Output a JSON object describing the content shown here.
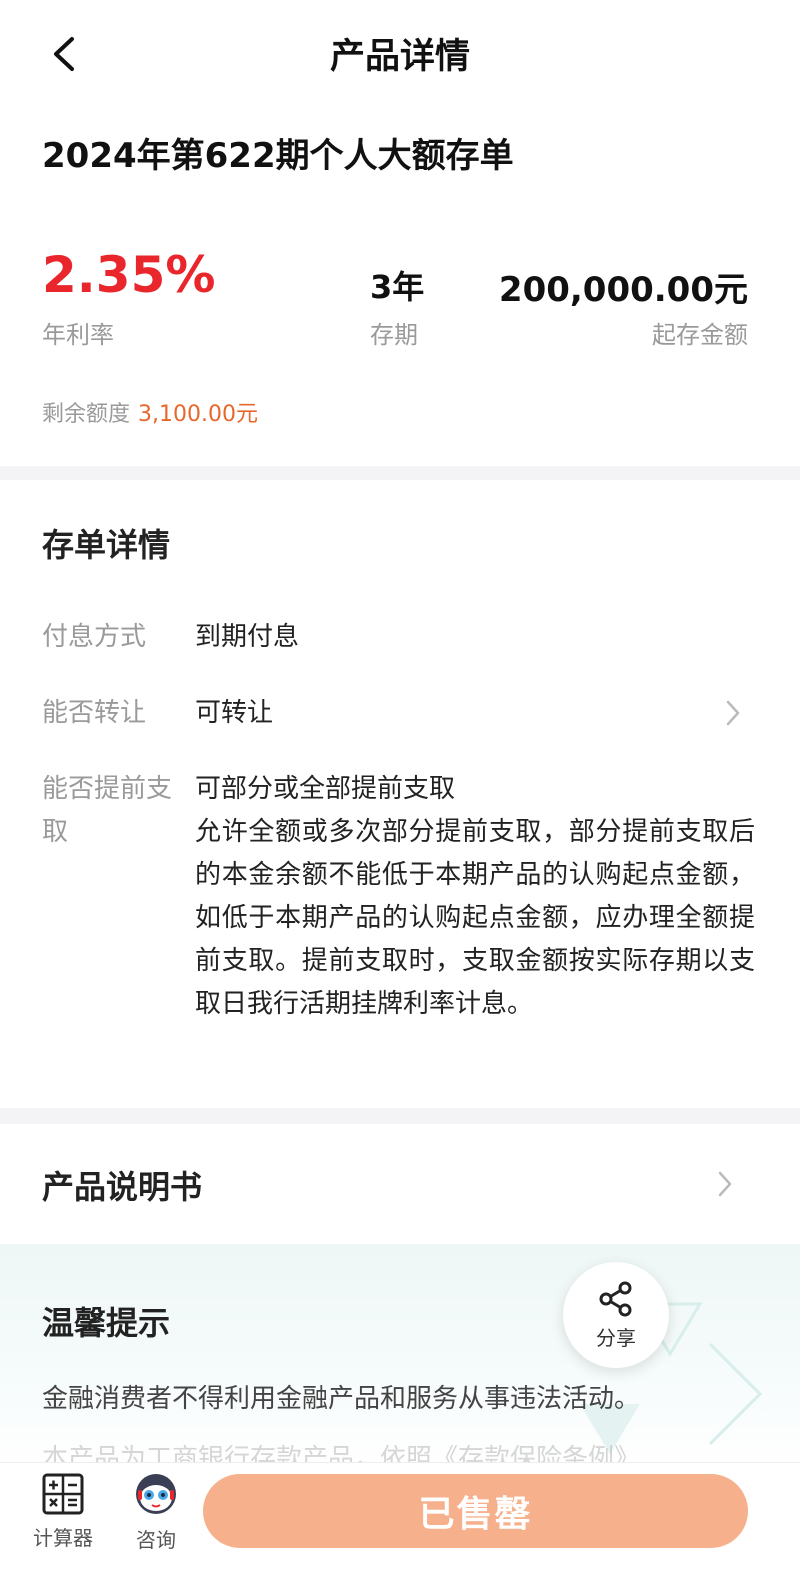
{
  "header": {
    "title": "产品详情",
    "back_icon": "chevron-left-icon"
  },
  "product": {
    "name": "2024年第622期个人大额存单"
  },
  "stats": {
    "rate_value": "2.35%",
    "rate_label": "年利率",
    "term_value": "3年",
    "term_label": "存期",
    "min_value": "200,000.00元",
    "min_label": "起存金额",
    "remaining_label": "剩余额度",
    "remaining_value": "3,100.00元"
  },
  "details": {
    "title": "存单详情",
    "rows": [
      {
        "label": "付息方式",
        "value": "到期付息"
      },
      {
        "label": "能否转让",
        "value": "可转让"
      },
      {
        "label": "能否提前支取",
        "value": "可部分或全部提前支取",
        "desc": "允许全额或多次部分提前支取，部分提前支取后的本金余额不能低于本期产品的认购起点金额，如低于本期产品的认购起点金额，应办理全额提前支取。提前支取时，支取金额按实际存期以支取日我行活期挂牌利率计息。"
      }
    ]
  },
  "manual": {
    "title": "产品说明书"
  },
  "tips": {
    "title": "温馨提示",
    "line1": "金融消费者不得利用金融产品和服务从事违法活动。",
    "line2": "本产品为工商银行存款产品，依照《存款保险条例》"
  },
  "share": {
    "label": "分享",
    "icon": "share-icon"
  },
  "bottom": {
    "calculator_label": "计算器",
    "consult_label": "咨询",
    "action_label": "已售罄"
  },
  "colors": {
    "rate": "#e8262b",
    "remaining": "#e8672c",
    "action_button": "#f6b08c",
    "separator": "#f4f4f6"
  }
}
